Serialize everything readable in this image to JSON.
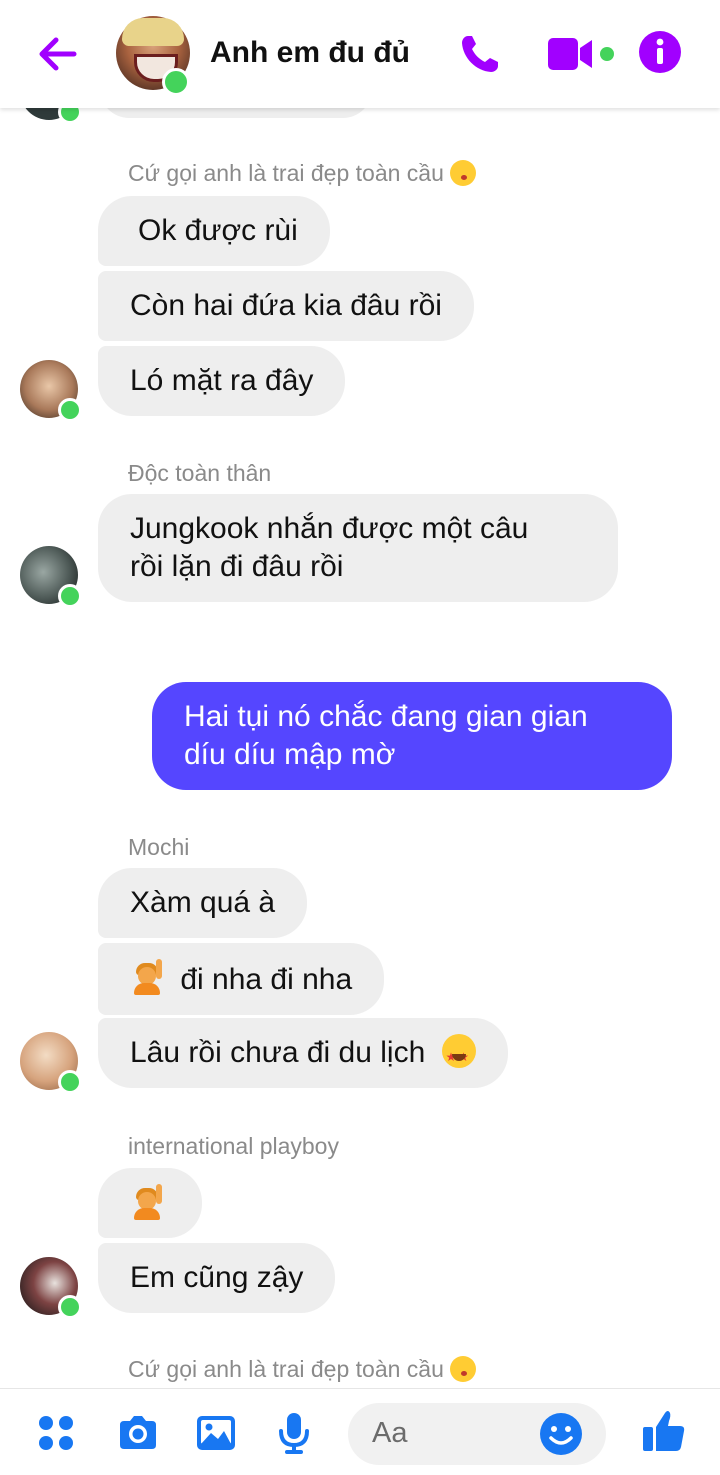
{
  "header": {
    "title": "Anh em đu đủ",
    "accent_color": "#a100ff",
    "icons": [
      "back-arrow-icon",
      "phone-icon",
      "video-camera-icon",
      "info-icon"
    ]
  },
  "conversation": {
    "senders": {
      "s1": "Cứ gọi anh là trai đẹp toàn cầu",
      "s2": "Độc toàn thân",
      "s3": "Mochi",
      "s4": "international playboy",
      "s5": "Cứ gọi anh là trai đẹp toàn cầu"
    },
    "messages": {
      "m1": "Ok được rùi",
      "m2": "Còn hai đứa kia đâu rồi",
      "m3": "Ló mặt ra đây",
      "m4_line1": "Jungkook nhắn được một câu",
      "m4_line2": "rồi lặn đi đâu rồi",
      "m5_line1": "Hai tụi nó chắc đang gian gian",
      "m5_line2": "díu díu mập mờ",
      "m6": "Xàm quá à",
      "m7": "đi nha đi nha",
      "m8": "Lâu rồi chưa đi du lịch",
      "m10": "Em cũng zậy"
    },
    "bubble_color_other": "#eeeeee",
    "bubble_color_mine": "#5546ff"
  },
  "composer": {
    "placeholder": "Aa",
    "icons": [
      "menu-dots-icon",
      "camera-icon",
      "gallery-icon",
      "microphone-icon",
      "emoji-smile-icon",
      "thumbs-up-icon"
    ]
  }
}
